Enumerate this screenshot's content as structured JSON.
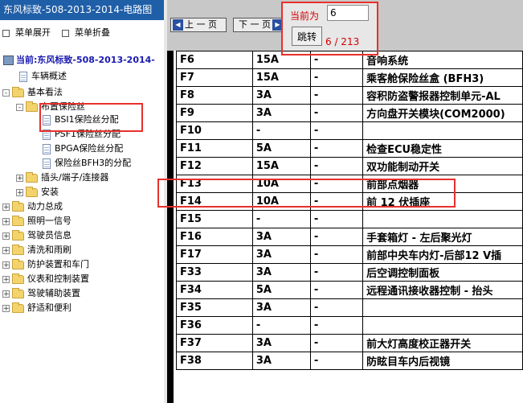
{
  "left_panel": {
    "title": "东风标致-508-2013-2014-电路图",
    "expand_all": "菜单展开",
    "collapse_all": "菜单折叠",
    "tree": [
      {
        "label": "当前:东风标致-508-2013-2014-",
        "icon": "root"
      },
      {
        "label": "车辆概述",
        "icon": "doc"
      },
      {
        "label": "基本看法",
        "icon": "folder",
        "toggle": "-"
      },
      {
        "label": "布置保险丝",
        "icon": "folder",
        "toggle": "-"
      },
      {
        "label": "BSI1保险丝分配",
        "icon": "doc",
        "selected": true
      },
      {
        "label": "PSF1保险丝分配",
        "icon": "doc"
      },
      {
        "label": "BPGA保险丝分配",
        "icon": "doc"
      },
      {
        "label": "保险丝BFH3的分配",
        "icon": "doc"
      },
      {
        "label": "插头/端子/连接器",
        "icon": "folder",
        "toggle": "+"
      },
      {
        "label": "安装",
        "icon": "folder",
        "toggle": "+"
      },
      {
        "label": "动力总成",
        "icon": "folder",
        "toggle": "+"
      },
      {
        "label": "照明一信号",
        "icon": "folder",
        "toggle": "+"
      },
      {
        "label": "驾驶员信息",
        "icon": "folder",
        "toggle": "+"
      },
      {
        "label": "清洗和雨刷",
        "icon": "folder",
        "toggle": "+"
      },
      {
        "label": "防护装置和车门",
        "icon": "folder",
        "toggle": "+"
      },
      {
        "label": "仪表和控制装置",
        "icon": "folder",
        "toggle": "+"
      },
      {
        "label": "驾驶辅助装置",
        "icon": "folder",
        "toggle": "+"
      },
      {
        "label": "舒适和便利",
        "icon": "folder",
        "toggle": "+"
      }
    ]
  },
  "toolbar": {
    "prev_label": "上 一 页",
    "next_label": "下 一 页",
    "current_label": "当前为",
    "current_page": "6",
    "jump_label": "跳转",
    "page_count": "6 / 213"
  },
  "fuse_rows": [
    [
      "F6",
      "15A",
      "-",
      "音响系统"
    ],
    [
      "F7",
      "15A",
      "-",
      "乘客舱保险丝盒 (BFH3)"
    ],
    [
      "F8",
      "3A",
      "-",
      "容积防盗警报器控制单元-AL"
    ],
    [
      "F9",
      "3A",
      "-",
      "方向盘开关模块(COM2000)"
    ],
    [
      "F10",
      "-",
      "-",
      ""
    ],
    [
      "F11",
      "5A",
      "-",
      "检查ECU稳定性"
    ],
    [
      "F12",
      "15A",
      "-",
      "双功能制动开关"
    ],
    [
      "F13",
      "10A",
      "-",
      "前部点烟器"
    ],
    [
      "F14",
      "10A",
      "-",
      "前 12 伏插座"
    ],
    [
      "F15",
      "-",
      "-",
      ""
    ],
    [
      "F16",
      "3A",
      "-",
      "手套箱灯 - 左后聚光灯"
    ],
    [
      "F17",
      "3A",
      "-",
      "前部中央车内灯-后部12 V插"
    ],
    [
      "F33",
      "3A",
      "-",
      "后空调控制面板"
    ],
    [
      "F34",
      "5A",
      "-",
      "远程通讯接收器控制 - 抬头"
    ],
    [
      "F35",
      "3A",
      "-",
      ""
    ],
    [
      "F36",
      "-",
      "-",
      ""
    ],
    [
      "F37",
      "3A",
      "-",
      "前大灯高度校正器开关"
    ],
    [
      "F38",
      "3A",
      "-",
      "防眩目车内后视镜"
    ]
  ],
  "colors": {
    "highlight": "#e8302c",
    "title_bar": "#1f5fa8",
    "page_red": "#d00000"
  }
}
